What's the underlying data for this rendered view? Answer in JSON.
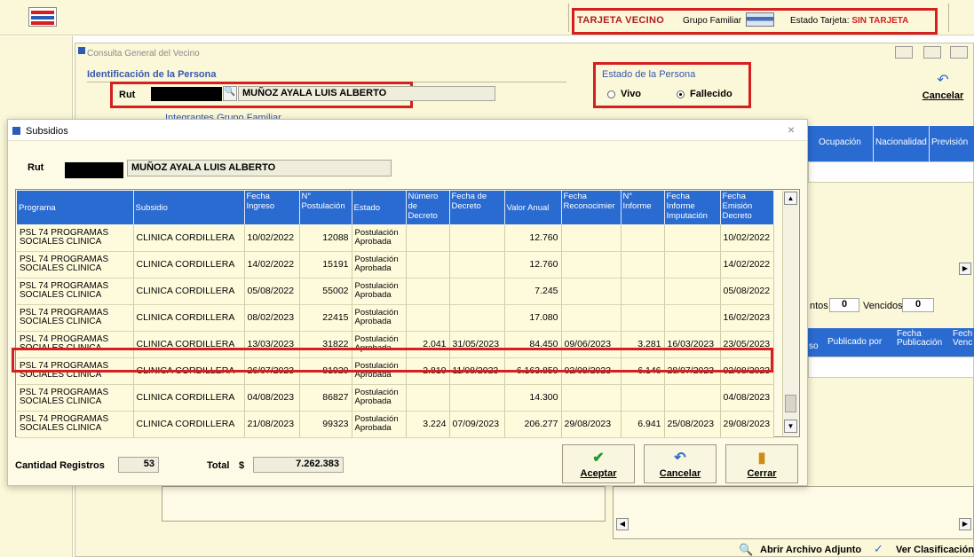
{
  "topbar": {
    "tarjeta_vecino": "TARJETA VECINO",
    "grupo_familiar": "Grupo Familiar",
    "estado_tarjeta_label": "Estado Tarjeta:",
    "estado_tarjeta_value": "SIN TARJETA"
  },
  "bg_window": {
    "title": "Consulta General del Vecino",
    "identificacion_label": "Identificación de la Persona",
    "rut_label": "Rut",
    "persona_nombre": "MUÑOZ AYALA LUIS ALBERTO",
    "estado_persona_label": "Estado de la Persona",
    "vivo_label": "Vivo",
    "fallecido_label": "Fallecido",
    "cancelar_label": "Cancelar",
    "integrantes_label": "Integrantes Grupo Familiar",
    "cols_right": [
      "Ocupación",
      "Nacionalidad",
      "Previsión"
    ],
    "vigentes_label": "ntos",
    "vigentes_value": "0",
    "vencidos_label": "Vencidos",
    "vencidos_value": "0",
    "cols_lower": [
      "so",
      "Publicado por",
      "Fecha Publicación",
      "Fech Venc"
    ],
    "abrir_archivo": "Abrir Archivo Adjunto",
    "ver_clasificacion": "Ver Clasificación"
  },
  "dialog": {
    "title": "Subsidios",
    "rut_label": "Rut",
    "nombre": "MUÑOZ AYALA LUIS ALBERTO",
    "columns": [
      "Programa",
      "Subsidio",
      "Fecha Ingreso",
      "N° Postulación",
      "Estado",
      "Número de Decreto",
      "Fecha de Decreto",
      "Valor Anual",
      "Fecha Reconocimier",
      "N° Informe",
      "Fecha Informe Imputación",
      "Fecha Emisión Decreto"
    ],
    "rows": [
      [
        "PSL 74 PROGRAMAS SOCIALES CLINICA",
        "CLINICA CORDILLERA",
        "10/02/2022",
        "12088",
        "Postulación Aprobada",
        "",
        "",
        "12.760",
        "",
        "",
        "",
        "10/02/2022"
      ],
      [
        "PSL 74 PROGRAMAS SOCIALES CLINICA",
        "CLINICA CORDILLERA",
        "14/02/2022",
        "15191",
        "Postulación Aprobada",
        "",
        "",
        "12.760",
        "",
        "",
        "",
        "14/02/2022"
      ],
      [
        "PSL 74 PROGRAMAS SOCIALES CLINICA",
        "CLINICA CORDILLERA",
        "05/08/2022",
        "55002",
        "Postulación Aprobada",
        "",
        "",
        "7.245",
        "",
        "",
        "",
        "05/08/2022"
      ],
      [
        "PSL 74 PROGRAMAS SOCIALES CLINICA",
        "CLINICA CORDILLERA",
        "08/02/2023",
        "22415",
        "Postulación Aprobada",
        "",
        "",
        "17.080",
        "",
        "",
        "",
        "16/02/2023"
      ],
      [
        "PSL 74 PROGRAMAS SOCIALES CLINICA",
        "CLINICA CORDILLERA",
        "13/03/2023",
        "31822",
        "Postulación Aprobada",
        "2.041",
        "31/05/2023",
        "84.450",
        "09/06/2023",
        "3.281",
        "16/03/2023",
        "23/05/2023"
      ],
      [
        "PSL 74 PROGRAMAS SOCIALES CLINICA",
        "CLINICA CORDILLERA",
        "26/07/2023",
        "81920",
        "Postulación Aprobada",
        "2.810",
        "11/08/2023",
        "6.163.850",
        "02/08/2023",
        "6.146",
        "28/07/2023",
        "02/08/2023"
      ],
      [
        "PSL 74 PROGRAMAS SOCIALES CLINICA",
        "CLINICA CORDILLERA",
        "04/08/2023",
        "86827",
        "Postulación Aprobada",
        "",
        "",
        "14.300",
        "",
        "",
        "",
        "04/08/2023"
      ],
      [
        "PSL 74 PROGRAMAS SOCIALES CLINICA",
        "CLINICA CORDILLERA",
        "21/08/2023",
        "99323",
        "Postulación Aprobada",
        "3.224",
        "07/09/2023",
        "206.277",
        "29/08/2023",
        "6.941",
        "25/08/2023",
        "29/08/2023"
      ]
    ],
    "cantidad_label": "Cantidad Registros",
    "cantidad_value": "53",
    "total_label": "Total",
    "currency": "$",
    "total_value": "7.262.383",
    "aceptar": "Aceptar",
    "cancelar": "Cancelar",
    "cerrar": "Cerrar"
  }
}
